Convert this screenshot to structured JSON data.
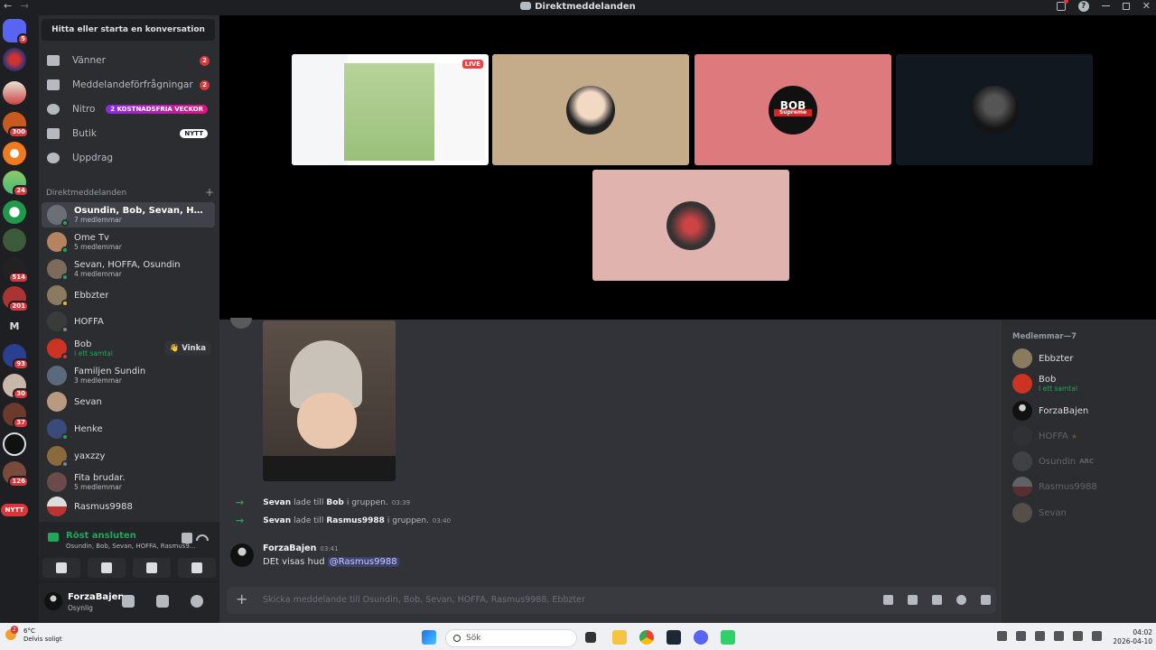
{
  "titlebar": {
    "title": "Direktmeddelanden",
    "back": "←",
    "forward": "→"
  },
  "guilds": {
    "badges": [
      "5",
      "300",
      "24",
      "514",
      "201",
      "93",
      "30",
      "37",
      "126"
    ],
    "m_label": "M",
    "new_label": "NYTT"
  },
  "sidebar": {
    "search_label": "Hitta eller starta en konversation",
    "nav": [
      {
        "label": "Vänner",
        "count": "2"
      },
      {
        "label": "Meddelandeförfrågningar",
        "count": "2"
      },
      {
        "label": "Nitro",
        "pill": "2 KOSTNADSFRIA VECKOR"
      },
      {
        "label": "Butik",
        "pill": "NYTT"
      },
      {
        "label": "Uppdrag"
      }
    ],
    "dm_header": "Direktmeddelanden",
    "dm_add": "+",
    "dms": [
      {
        "name": "Osundin, Bob, Sevan, HOFFA, R...",
        "sub": "7 medlemmar"
      },
      {
        "name": "Ome Tv",
        "sub": "5 medlemmar"
      },
      {
        "name": "Sevan, HOFFA, Osundin",
        "sub": "4 medlemmar"
      },
      {
        "name": "Ebbzter",
        "sub": ""
      },
      {
        "name": "HOFFA",
        "sub": ""
      },
      {
        "name": "Bob",
        "sub": "I ett samtal",
        "wave": "Vinka"
      },
      {
        "name": "Familjen Sundin",
        "sub": "3 medlemmar"
      },
      {
        "name": "Sevan",
        "sub": ""
      },
      {
        "name": "Henke",
        "sub": ""
      },
      {
        "name": "yaxzzy",
        "sub": ""
      },
      {
        "name": "Fita brudar.",
        "sub": "5 medlemmar"
      },
      {
        "name": "Rasmus9988",
        "sub": ""
      }
    ]
  },
  "voice": {
    "status": "Röst ansluten",
    "channel": "Osundin, Bob, Sevan, HOFFA, Rasmus9..."
  },
  "user": {
    "name": "ForzaBajen",
    "status": "Osynlig"
  },
  "stage": {
    "live_label": "LIVE",
    "bob_tile_text": "BOB",
    "bob_tile_sub": "Supreme"
  },
  "chat": {
    "system_messages": [
      {
        "actor": "Sevan",
        "verb": "lade till",
        "target": "Bob",
        "suffix": "i gruppen.",
        "time": "03:39"
      },
      {
        "actor": "Sevan",
        "verb": "lade till",
        "target": "Rasmus9988",
        "suffix": "i gruppen.",
        "time": "03:40"
      }
    ],
    "message": {
      "author": "ForzaBajen",
      "time": "03:41",
      "text": "DEt visas hud",
      "mention": "@Rasmus9988"
    },
    "composer_placeholder": "Skicka meddelande till Osundin, Bob, Sevan, HOFFA, Rasmus9988, Ebbzter",
    "plus": "+"
  },
  "members": {
    "header": "Medlemmar—7",
    "list": [
      {
        "name": "Ebbzter",
        "sub": ""
      },
      {
        "name": "Bob",
        "sub": "I ett samtal"
      },
      {
        "name": "ForzaBajen",
        "sub": ""
      },
      {
        "name": "HOFFA",
        "sub": ""
      },
      {
        "name": "Osundin",
        "sub": "",
        "tag": "ARC"
      },
      {
        "name": "Rasmus9988",
        "sub": ""
      },
      {
        "name": "Sevan",
        "sub": ""
      }
    ]
  },
  "taskbar": {
    "temp": "6°C",
    "weather": "Delvis soligt",
    "weather_badge": "2",
    "search_placeholder": "Sök",
    "time": "04:02",
    "date": "2026-04-10"
  },
  "colors": {
    "accent": "#5865f2",
    "online": "#23a55a",
    "danger": "#da373c",
    "bg": "#313338"
  }
}
